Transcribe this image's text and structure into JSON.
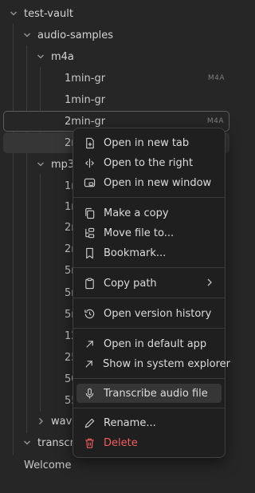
{
  "tree": {
    "vault": "test-vault",
    "audio_samples": "audio-samples",
    "m4a": "m4a",
    "files_m4a": [
      {
        "name": "1min-gr",
        "badge": "M4A"
      },
      {
        "name": "1min-gr",
        "badge": ""
      },
      {
        "name": "2min-gr",
        "badge": "M4A"
      },
      {
        "name": "2r",
        "badge": ""
      }
    ],
    "mp3": "mp3",
    "files_mp3": [
      "1r",
      "1r",
      "2r",
      "2r",
      "5r",
      "5r",
      "5r",
      "12",
      "25",
      "50",
      "55"
    ],
    "wav": "wav",
    "transcripts": "transcrip",
    "welcome": "Welcome"
  },
  "menu": {
    "items": [
      {
        "label": "Open in new tab",
        "icon": "new-tab-icon"
      },
      {
        "label": "Open to the right",
        "icon": "split-right-icon"
      },
      {
        "label": "Open in new window",
        "icon": "new-window-icon"
      },
      {
        "label": "Make a copy",
        "icon": "copy-icon"
      },
      {
        "label": "Move file to...",
        "icon": "move-file-icon"
      },
      {
        "label": "Bookmark...",
        "icon": "bookmark-icon"
      },
      {
        "label": "Copy path",
        "icon": "clipboard-icon"
      },
      {
        "label": "Open version history",
        "icon": "history-icon"
      },
      {
        "label": "Open in default app",
        "icon": "external-link-icon"
      },
      {
        "label": "Show in system explorer",
        "icon": "external-link-icon"
      },
      {
        "label": "Transcribe audio file",
        "icon": "microphone-icon"
      },
      {
        "label": "Rename...",
        "icon": "pencil-icon"
      },
      {
        "label": "Delete",
        "icon": "trash-icon"
      }
    ]
  },
  "colors": {
    "background": "#262626",
    "menu_background": "#1f1f1f",
    "delete": "#f25c5c",
    "hover": "#363636"
  }
}
